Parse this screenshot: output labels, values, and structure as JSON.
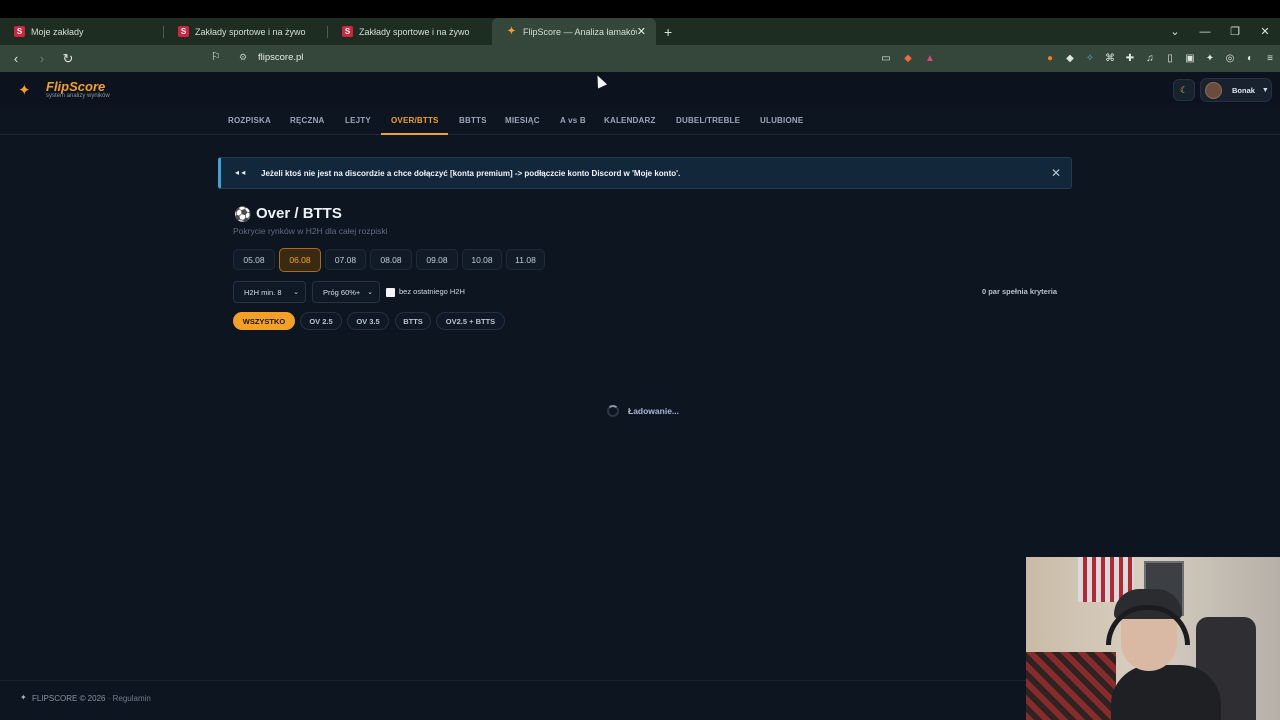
{
  "browser": {
    "tabs": [
      {
        "title": "Moje zakłady",
        "favicon": "S",
        "active": false
      },
      {
        "title": "Zakłady sportowe i na żywo",
        "favicon": "S",
        "active": false
      },
      {
        "title": "Zakłady sportowe i na żywo",
        "favicon": "S",
        "active": false
      },
      {
        "title": "FlipScore — Analiza łamaków p",
        "favicon": "flipscore-logo",
        "active": true
      }
    ],
    "new_tab": "+",
    "url": "flipscore.pl"
  },
  "site": {
    "logo_title": "FlipScore",
    "logo_subtitle": "system analizy wyników",
    "user_name": "Bonak"
  },
  "nav": {
    "items": [
      "ROZPISKA",
      "RĘCZNA",
      "LEJTY",
      "OVER/BTTS",
      "BBTTS",
      "MIESIĄC",
      "A vs B",
      "KALENDARZ",
      "DUBEL/TREBLE",
      "ULUBIONE"
    ],
    "active": "OVER/BTTS"
  },
  "banner": {
    "text": "Jeżeli ktoś nie jest na discordzie a chce dołączyć [konta premium] -> podłączcie konto Discord w 'Moje konto'."
  },
  "main": {
    "title": "Over / BTTS",
    "subtitle": "Pokrycie rynków w H2H dla całej rozpiski",
    "dates": [
      "05.08",
      "06.08",
      "07.08",
      "08.08",
      "09.08",
      "10.08",
      "11.08"
    ],
    "selected_date": "06.08",
    "filter_h2h": "H2H min. 8",
    "filter_threshold": "Próg 60%+",
    "checkbox_label": "bez ostatniego H2H",
    "criteria_text": "0 par spełnia kryteria",
    "market_filters": [
      "WSZYSTKO",
      "OV 2.5",
      "OV 3.5",
      "BTTS",
      "OV2.5 + BTTS"
    ],
    "selected_market": "WSZYSTKO",
    "loading_text": "Ładowanie..."
  },
  "footer": {
    "brand": "FLIPSCORE © 2026",
    "separator": "·",
    "link": "Regulamin"
  },
  "colors": {
    "accent": "#f3a028",
    "page_bg": "#0d1521",
    "banner_border": "#3fa3d8"
  }
}
